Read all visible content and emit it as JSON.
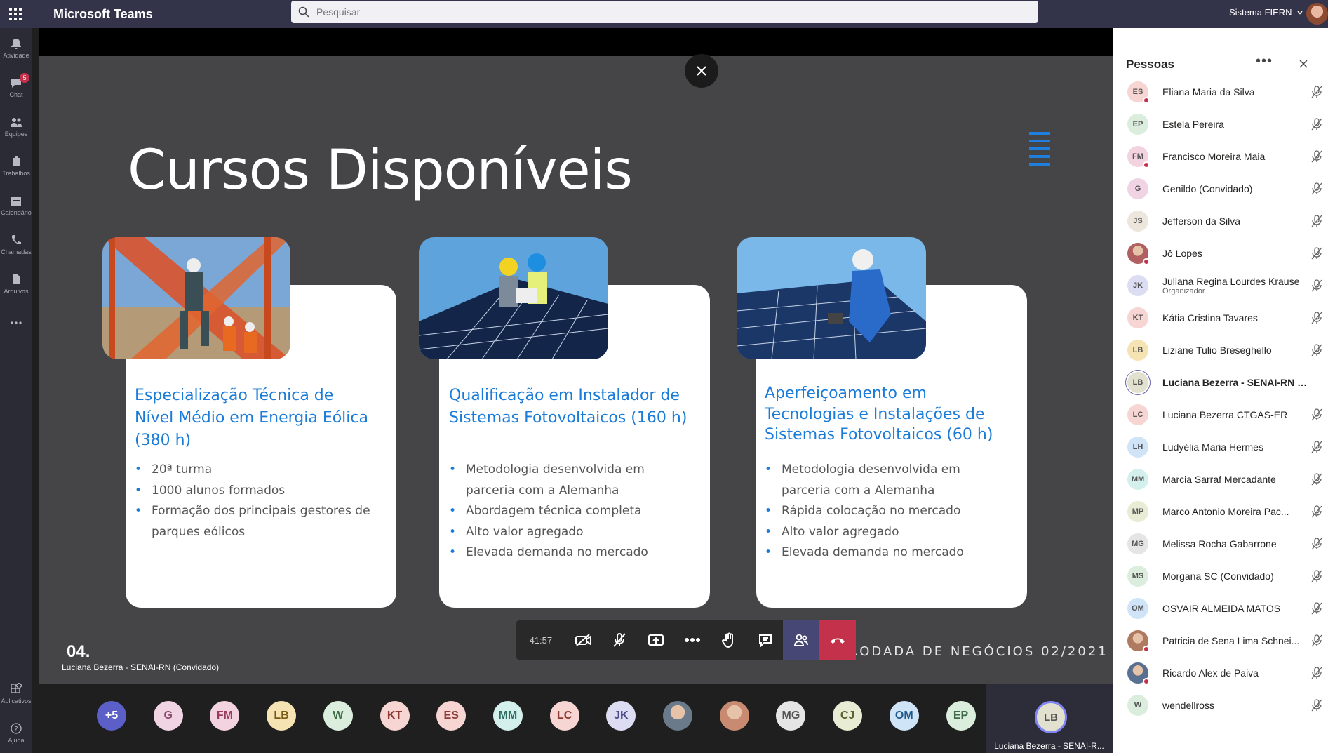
{
  "topbar": {
    "app_title": "Microsoft Teams",
    "search_placeholder": "Pesquisar",
    "org": "Sistema FIERN"
  },
  "rail": [
    {
      "label": "Atividade",
      "icon": "bell-icon"
    },
    {
      "label": "Chat",
      "icon": "chat-icon",
      "badge": "5"
    },
    {
      "label": "Equipes",
      "icon": "teams-icon"
    },
    {
      "label": "Trabalhos",
      "icon": "assignments-icon"
    },
    {
      "label": "Calendário",
      "icon": "calendar-icon"
    },
    {
      "label": "Chamadas",
      "icon": "phone-icon"
    },
    {
      "label": "Arquivos",
      "icon": "files-icon"
    },
    {
      "label": "...",
      "icon": "more-icon"
    }
  ],
  "rail_bottom": [
    {
      "label": "Aplicativos",
      "icon": "apps-icon"
    },
    {
      "label": "Ajuda",
      "icon": "help-icon"
    }
  ],
  "slide": {
    "title": "Cursos Disponíveis",
    "number": "04.",
    "footer": "CENTRAL DE TUTORIA E MONITORIA | RODADA DE NEGÓCIOS 02/2021",
    "cards": [
      {
        "title": "Especialização Técnica de Nível Médio em Energia Eólica (380 h)",
        "bullets": [
          "20ª turma",
          "1000 alunos formados",
          "Formação dos principais gestores de parques eólicos"
        ]
      },
      {
        "title": "Qualificação em Instalador de Sistemas Fotovoltaicos (160 h)",
        "bullets": [
          "Metodologia desenvolvida em parceria com a Alemanha",
          "Abordagem técnica completa",
          "Alto valor agregado",
          "Elevada demanda no mercado"
        ]
      },
      {
        "title": "Aperfeiçoamento em Tecnologias e Instalações de Sistemas Fotovoltaicos (60 h)",
        "bullets": [
          "Metodologia desenvolvida em parceria com a Alemanha",
          "Rápida colocação no mercado",
          "Alto valor agregado",
          "Elevada demanda no mercado"
        ]
      }
    ]
  },
  "meeting": {
    "timer": "41:57",
    "speaker_label": "Luciana Bezerra - SENAI-RN (Convidado)",
    "presenter_initials": "LB",
    "presenter_name": "Luciana Bezerra - SENAI-R..."
  },
  "strip": [
    {
      "i": "+5",
      "bg": "#5b5fc7",
      "fg": "#ffffff"
    },
    {
      "i": "G",
      "bg": "#f0d4e4",
      "fg": "#8a4a70"
    },
    {
      "i": "FM",
      "bg": "#f4d3e0",
      "fg": "#9a3b5c"
    },
    {
      "i": "LB",
      "bg": "#f5e3b3",
      "fg": "#7a5a14"
    },
    {
      "i": "W",
      "bg": "#dbeedd",
      "fg": "#3d6b45"
    },
    {
      "i": "KT",
      "bg": "#f6d5d2",
      "fg": "#8c3a33"
    },
    {
      "i": "ES",
      "bg": "#f6d5d2",
      "fg": "#8c3a33"
    },
    {
      "i": "MM",
      "bg": "#d4f0ec",
      "fg": "#2d6b63"
    },
    {
      "i": "LC",
      "bg": "#f6d5d2",
      "fg": "#8c3a33"
    },
    {
      "i": "JK",
      "bg": "#dcdcf2",
      "fg": "#4b4b8a"
    },
    {
      "i": "",
      "bg": "#6a7a8a",
      "fg": "#ffffff",
      "photo": true
    },
    {
      "i": "",
      "bg": "#c88a70",
      "fg": "#ffffff",
      "photo": true
    },
    {
      "i": "MG",
      "bg": "#e5e5e5",
      "fg": "#555555"
    },
    {
      "i": "CJ",
      "bg": "#e8ecd4",
      "fg": "#5a6230"
    },
    {
      "i": "OM",
      "bg": "#cfe4f7",
      "fg": "#1f5a8f"
    },
    {
      "i": "EP",
      "bg": "#dbeedd",
      "fg": "#3d6b45"
    }
  ],
  "panel": {
    "title": "Pessoas",
    "people": [
      {
        "i": "ES",
        "name": "Eliana Maria da Silva",
        "bg": "#f6d5d2",
        "dot": true
      },
      {
        "i": "EP",
        "name": "Estela Pereira",
        "bg": "#dbeedd",
        "dot": false
      },
      {
        "i": "FM",
        "name": "Francisco Moreira Maia",
        "bg": "#f4d3e0",
        "dot": true
      },
      {
        "i": "G",
        "name": "Genildo (Convidado)",
        "bg": "#f0d4e4",
        "dot": false
      },
      {
        "i": "JS",
        "name": "Jefferson da Silva",
        "bg": "#ede6dc",
        "dot": false
      },
      {
        "i": "",
        "name": "Jô Lopes",
        "bg": "#b06060",
        "dot": true,
        "photo": true
      },
      {
        "i": "JK",
        "name": "Juliana Regina Lourdes Krause",
        "role": "Organizador",
        "bg": "#dcdcf2",
        "dot": false
      },
      {
        "i": "KT",
        "name": "Kátia Cristina Tavares",
        "bg": "#f6d5d2",
        "dot": false
      },
      {
        "i": "LB",
        "name": "Liziane Tulio Breseghello",
        "bg": "#f5e3b3",
        "dot": false
      },
      {
        "i": "LB",
        "name": "Luciana Bezerra - SENAI-RN (C...",
        "bg": "#e2e0cf",
        "dot": false,
        "bold": true
      },
      {
        "i": "LC",
        "name": "Luciana Bezerra CTGAS-ER",
        "bg": "#f6d5d2",
        "dot": false
      },
      {
        "i": "LH",
        "name": "Ludyélia Maria Hermes",
        "bg": "#cfe4f7",
        "dot": false
      },
      {
        "i": "MM",
        "name": "Marcia Sarraf Mercadante",
        "bg": "#d4f0ec",
        "dot": false
      },
      {
        "i": "MP",
        "name": "Marco Antonio Moreira Pac...",
        "bg": "#e8ecd4",
        "dot": false
      },
      {
        "i": "MG",
        "name": "Melissa Rocha Gabarrone",
        "bg": "#e5e5e5",
        "dot": false
      },
      {
        "i": "MS",
        "name": "Morgana SC (Convidado)",
        "bg": "#dbeedd",
        "dot": false
      },
      {
        "i": "OM",
        "name": "OSVAIR ALMEIDA MATOS",
        "bg": "#cfe4f7",
        "dot": false
      },
      {
        "i": "",
        "name": "Patricia de Sena Lima Schnei...",
        "bg": "#b07a60",
        "dot": true,
        "photo": true
      },
      {
        "i": "",
        "name": "Ricardo Alex de Paiva",
        "bg": "#5a7090",
        "dot": true,
        "photo": true
      },
      {
        "i": "W",
        "name": "wendellross",
        "bg": "#dbeedd",
        "dot": false
      }
    ]
  }
}
